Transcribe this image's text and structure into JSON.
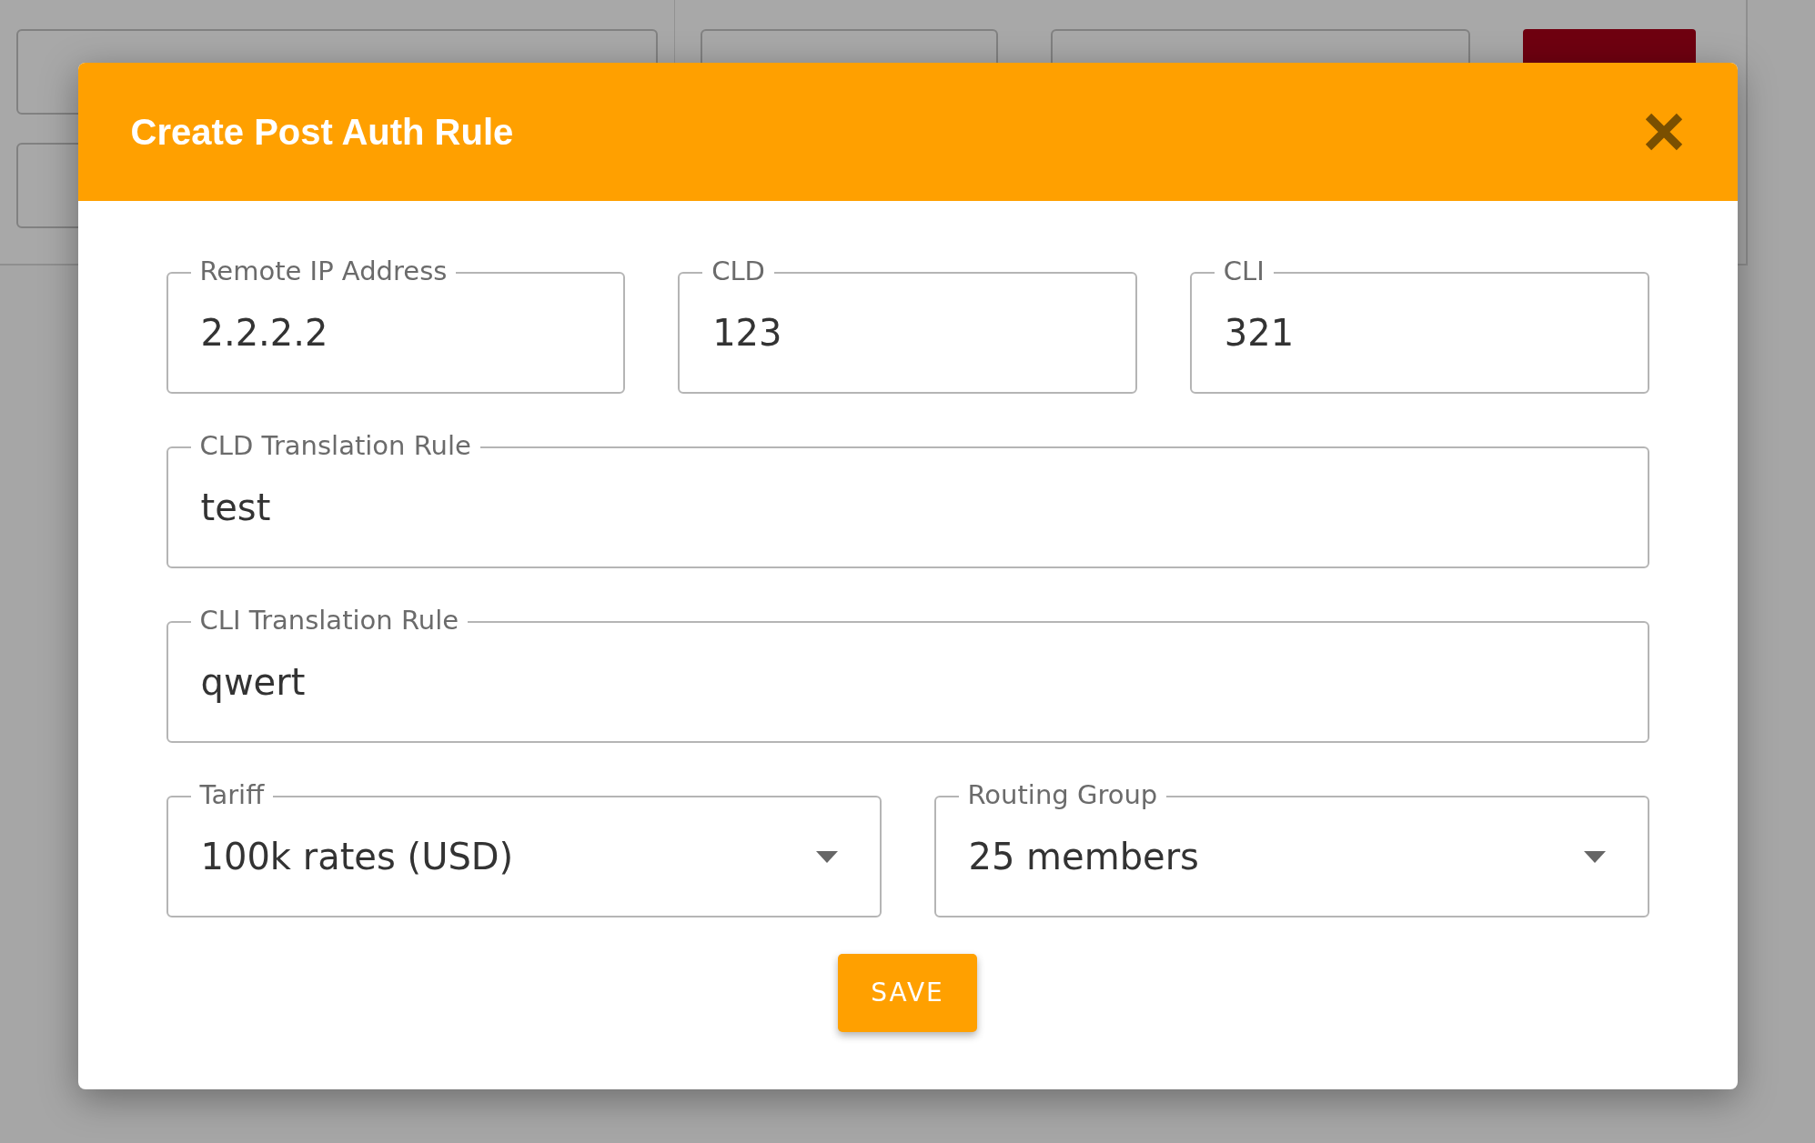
{
  "dialog": {
    "title": "Create Post Auth Rule",
    "rows": [
      [
        {
          "kind": "text",
          "label": "Remote IP Address",
          "value": "2.2.2.2"
        },
        {
          "kind": "text",
          "label": "CLD",
          "value": "123"
        },
        {
          "kind": "text",
          "label": "CLI",
          "value": "321"
        }
      ],
      [
        {
          "kind": "text",
          "label": "CLD Translation Rule",
          "value": "test"
        }
      ],
      [
        {
          "kind": "text",
          "label": "CLI Translation Rule",
          "value": "qwert"
        }
      ],
      [
        {
          "kind": "select",
          "label": "Tariff",
          "value": "100k rates (USD)"
        },
        {
          "kind": "select",
          "label": "Routing Group",
          "value": "25 members"
        }
      ]
    ],
    "save_button": "SAVE"
  }
}
